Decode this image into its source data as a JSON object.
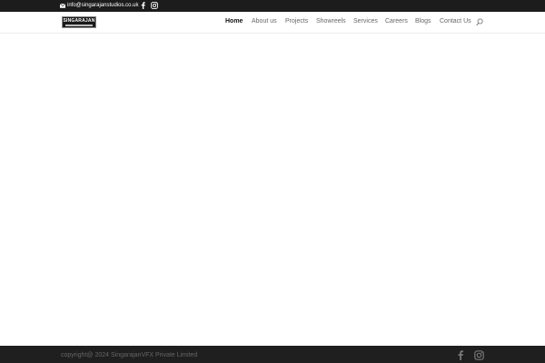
{
  "topbar": {
    "email": "info@singarajanstudios.co.uk",
    "icons": [
      "mail-icon",
      "facebook-icon",
      "instagram-icon"
    ]
  },
  "header": {
    "logo_text": "SINGARAJAN",
    "nav": {
      "home": "Home",
      "about": "About us",
      "projects": "Projects",
      "showreels": "Showreels",
      "services": "Services",
      "careers": "Careers",
      "blogs": "Blogs",
      "contact": "Contact Us"
    },
    "active_item": "Home"
  },
  "footer": {
    "copyright": "copyright@ 2024 SingarajanVFX Private Limited",
    "icons": [
      "facebook-icon",
      "instagram-icon"
    ]
  },
  "colors": {
    "topbar_bg": "#1c1c1c",
    "footer_bg": "#1f1f1f",
    "nav_text": "#666666",
    "nav_active": "#111111"
  }
}
